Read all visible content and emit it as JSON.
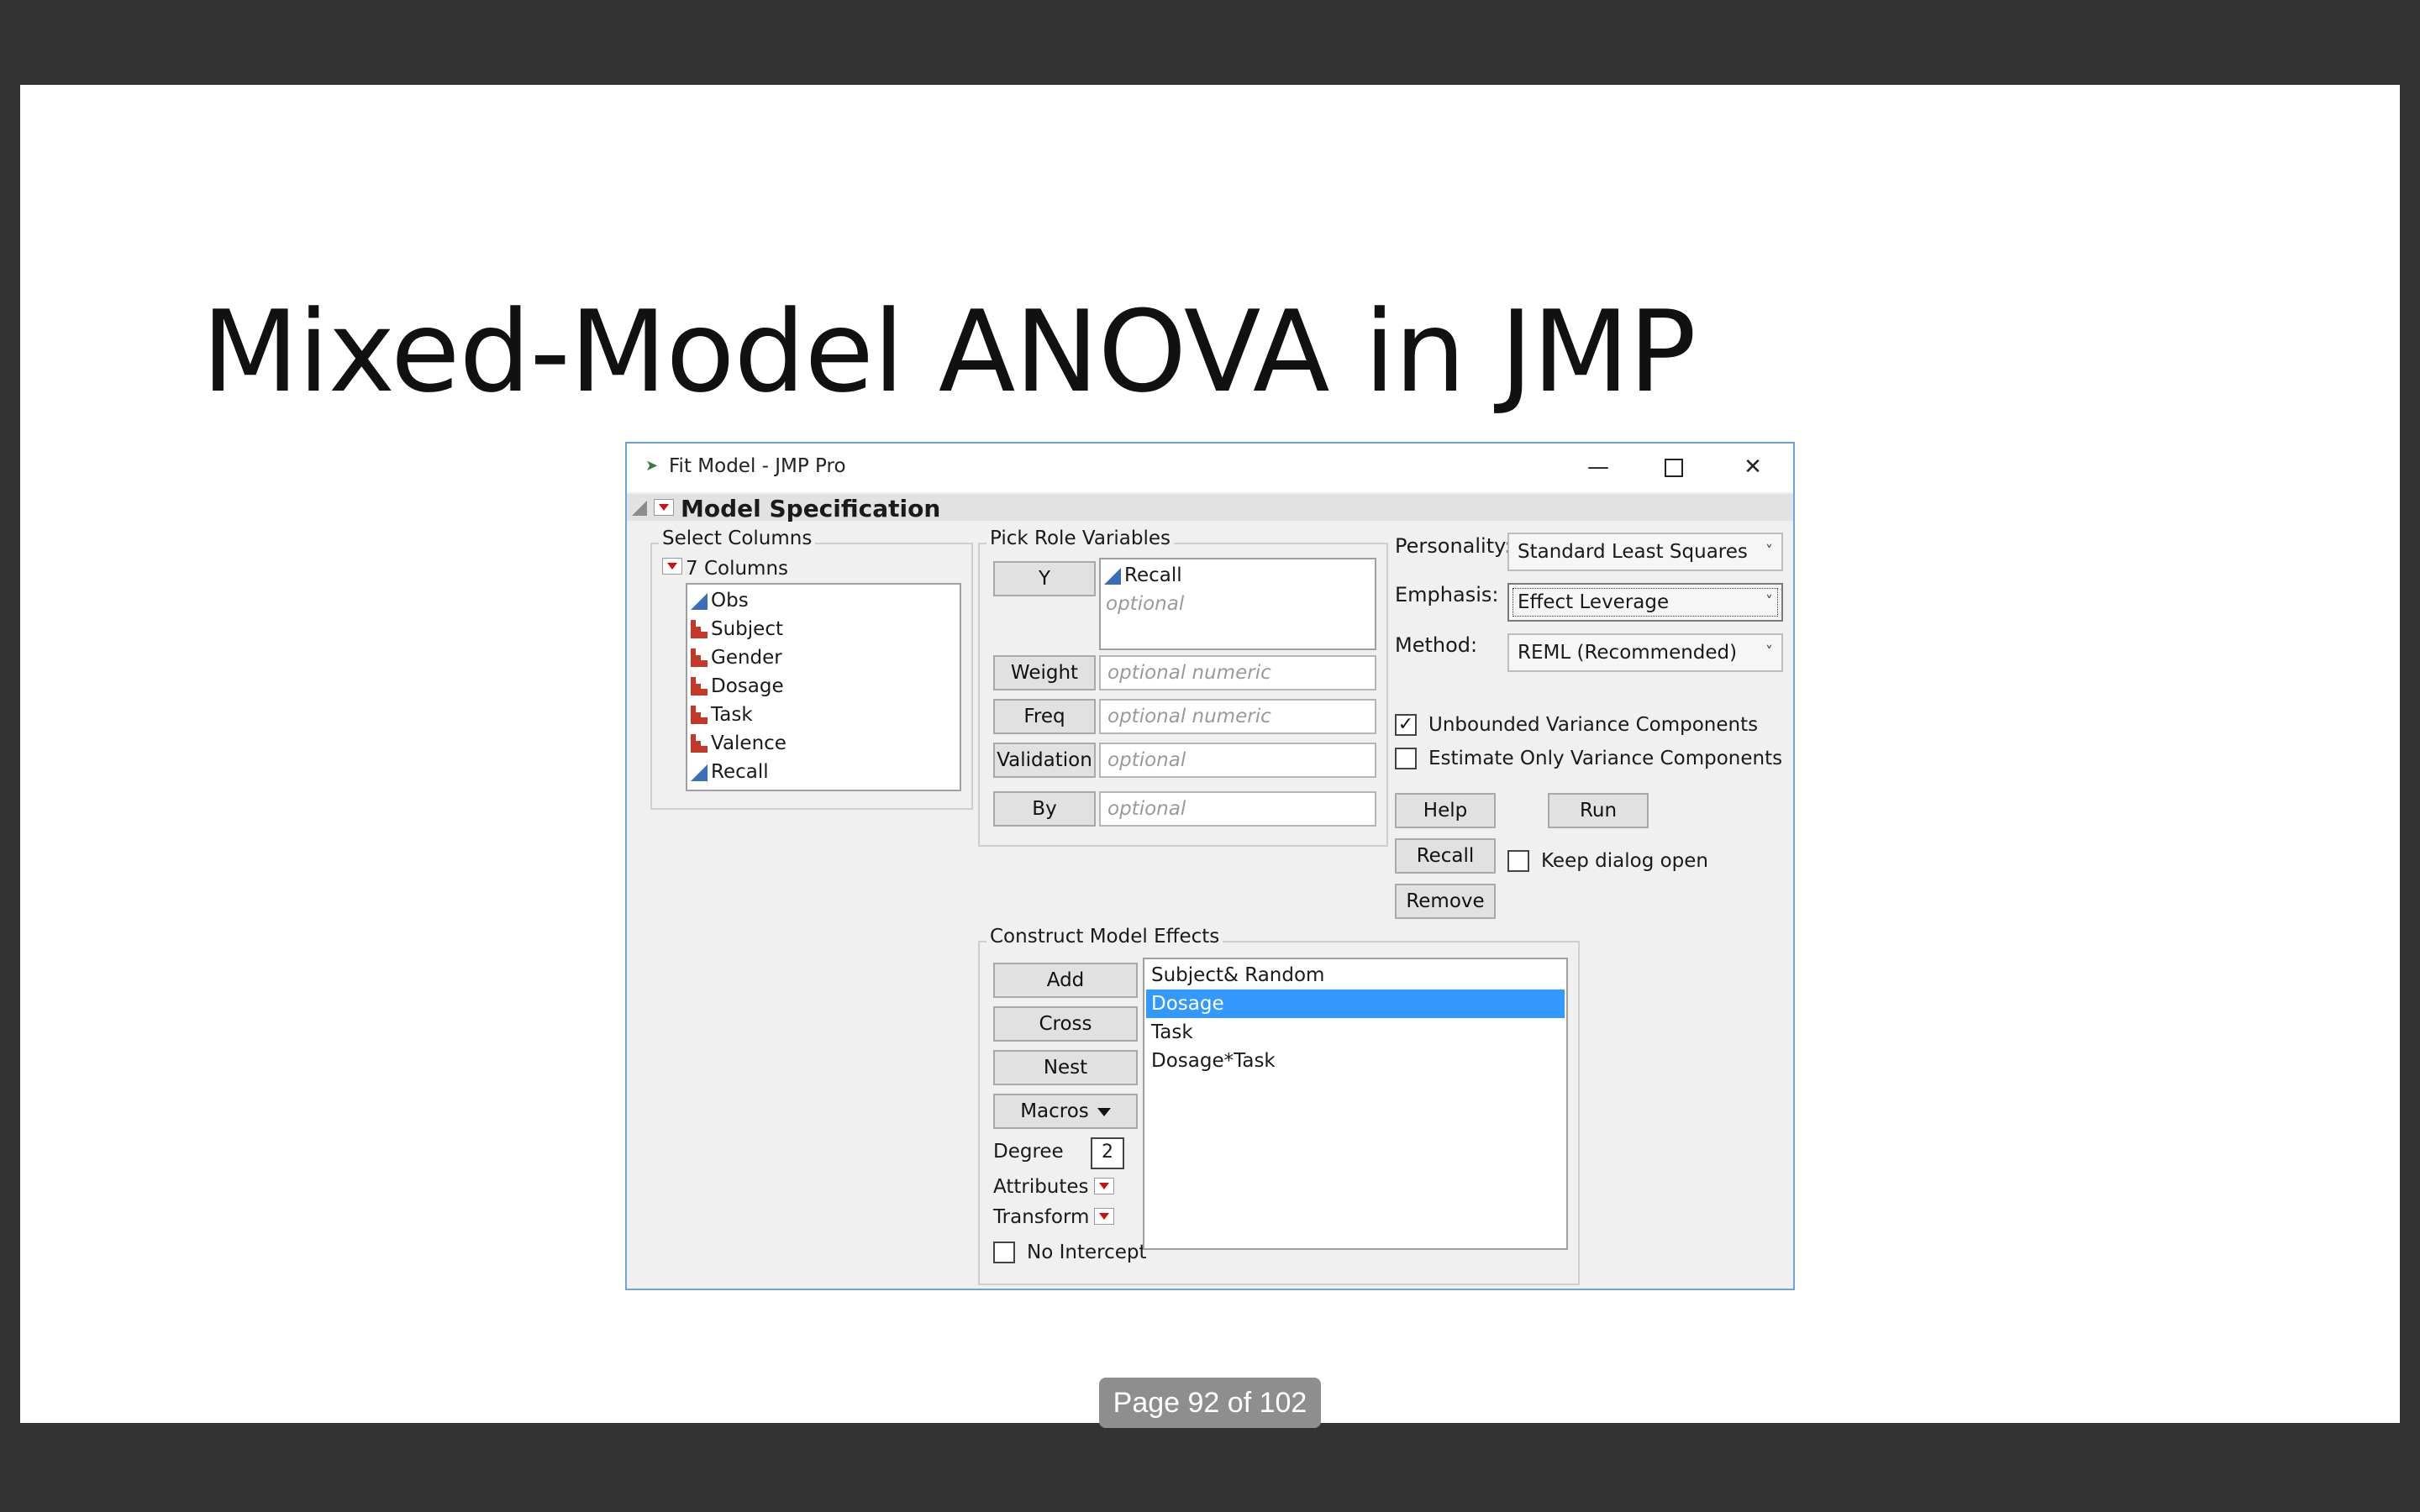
{
  "slide": {
    "title": "Mixed-Model ANOVA in JMP",
    "page_indicator": "Page 92 of 102"
  },
  "window": {
    "title": "Fit Model - JMP Pro",
    "minimize": "—",
    "close": "✕"
  },
  "spec": {
    "title": "Model Specification"
  },
  "select_columns": {
    "label": "Select Columns",
    "count_label": "7 Columns",
    "columns": [
      {
        "name": "Obs",
        "type": "continuous"
      },
      {
        "name": "Subject",
        "type": "nominal"
      },
      {
        "name": "Gender",
        "type": "nominal"
      },
      {
        "name": "Dosage",
        "type": "nominal"
      },
      {
        "name": "Task",
        "type": "nominal"
      },
      {
        "name": "Valence",
        "type": "nominal"
      },
      {
        "name": "Recall",
        "type": "continuous"
      }
    ]
  },
  "roles": {
    "label": "Pick Role Variables",
    "y_button": "Y",
    "y_value": "Recall",
    "y_placeholder": "optional",
    "weight_button": "Weight",
    "weight_placeholder": "optional numeric",
    "freq_button": "Freq",
    "freq_placeholder": "optional numeric",
    "validation_button": "Validation",
    "validation_placeholder": "optional",
    "by_button": "By",
    "by_placeholder": "optional"
  },
  "options": {
    "personality_label": "Personality:",
    "personality_value": "Standard Least Squares",
    "emphasis_label": "Emphasis:",
    "emphasis_value": "Effect Leverage",
    "method_label": "Method:",
    "method_value": "REML (Recommended)",
    "unbounded_label": "Unbounded Variance Components",
    "unbounded_checked": true,
    "estimate_only_label": "Estimate Only Variance Components",
    "estimate_only_checked": false,
    "help_button": "Help",
    "run_button": "Run",
    "recall_button": "Recall",
    "keep_open_label": "Keep dialog open",
    "keep_open_checked": false,
    "remove_button": "Remove"
  },
  "effects": {
    "label": "Construct Model Effects",
    "add_button": "Add",
    "cross_button": "Cross",
    "nest_button": "Nest",
    "macros_button": "Macros",
    "degree_label": "Degree",
    "degree_value": "2",
    "attributes_label": "Attributes",
    "transform_label": "Transform",
    "no_intercept_label": "No Intercept",
    "items": [
      "Subject& Random",
      "Dosage",
      "Task",
      "Dosage*Task"
    ],
    "selected_index": 1
  }
}
